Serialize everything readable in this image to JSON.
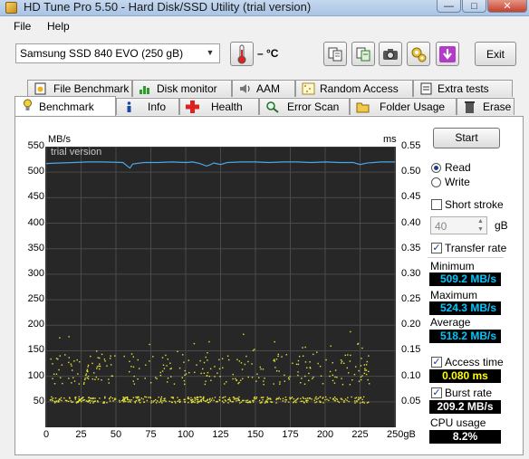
{
  "window": {
    "title": "HD Tune Pro 5.50 - Hard Disk/SSD Utility (trial version)",
    "min_glyph": "—",
    "max_glyph": "□",
    "close_glyph": "✕"
  },
  "menu": {
    "file": "File",
    "help": "Help"
  },
  "toolbar": {
    "drive": "Samsung SSD 840 EVO (250 gB)",
    "temperature": "– °C",
    "exit_label": "Exit"
  },
  "tabs_top": [
    "File Benchmark",
    "Disk monitor",
    "AAM",
    "Random Access",
    "Extra tests"
  ],
  "tabs_bottom": [
    "Benchmark",
    "Info",
    "Health",
    "Error Scan",
    "Folder Usage",
    "Erase"
  ],
  "active_tab": "Benchmark",
  "controls": {
    "start_label": "Start",
    "read_label": "Read",
    "write_label": "Write",
    "read_selected": true,
    "short_stroke_label": "Short stroke",
    "short_stroke_checked": false,
    "short_stroke_value": "40",
    "short_stroke_unit": "gB",
    "transfer_rate_label": "Transfer rate",
    "transfer_rate_checked": true,
    "access_time_label": "Access time",
    "access_time_checked": true,
    "burst_rate_label": "Burst rate",
    "burst_rate_checked": true
  },
  "stats": {
    "minimum_label": "Minimum",
    "minimum_value": "509.2 MB/s",
    "maximum_label": "Maximum",
    "maximum_value": "524.3 MB/s",
    "average_label": "Average",
    "average_value": "518.2 MB/s",
    "access_time_value": "0.080 ms",
    "burst_rate_value": "209.2 MB/s",
    "cpu_usage_label": "CPU usage",
    "cpu_usage_value": "8.2%"
  },
  "colors": {
    "chart_bg": "#272727",
    "grid": "#4a4a4a",
    "transfer_line": "#4aa7e8",
    "access_points": "#e7e33a",
    "value_cyan": "#00c8ff",
    "value_yellow": "#ffff00"
  },
  "chart_data": {
    "type": "line",
    "watermark": "trial version",
    "ylabel_left": "MB/s",
    "ylabel_right": "ms",
    "xlabel_unit": "gB",
    "x_ticks": [
      "0",
      "25",
      "50",
      "75",
      "100",
      "125",
      "150",
      "175",
      "200",
      "225",
      "250gB"
    ],
    "y_left_ticks": [
      "550",
      "500",
      "450",
      "400",
      "350",
      "300",
      "250",
      "200",
      "150",
      "100",
      "50"
    ],
    "y_right_ticks": [
      "0.55",
      "0.50",
      "0.45",
      "0.40",
      "0.35",
      "0.30",
      "0.25",
      "0.20",
      "0.15",
      "0.10",
      "0.05"
    ],
    "xlim": [
      0,
      250
    ],
    "ylim_left": [
      0,
      550
    ],
    "ylim_right": [
      0,
      0.55
    ],
    "series": [
      {
        "name": "Transfer rate",
        "axis": "left",
        "x": [
          0,
          10,
          20,
          30,
          40,
          55,
          60,
          62,
          70,
          80,
          90,
          100,
          105,
          110,
          115,
          118,
          120,
          125,
          130,
          140,
          150,
          160,
          170,
          180,
          190,
          200,
          210,
          220,
          225,
          230,
          240,
          250
        ],
        "y": [
          517,
          518,
          519,
          520,
          520,
          519,
          508,
          516,
          519,
          519,
          520,
          519,
          520,
          517,
          512,
          515,
          518,
          515,
          519,
          520,
          520,
          519,
          520,
          520,
          519,
          520,
          519,
          519,
          515,
          518,
          520,
          520
        ]
      },
      {
        "name": "Access time",
        "axis": "right",
        "style": "scatter",
        "bands": [
          {
            "y_center": 0.055,
            "spread": 0.006,
            "count": 420
          },
          {
            "y_center": 0.115,
            "spread": 0.03,
            "count": 260
          },
          {
            "y_center": 0.165,
            "spread": 0.025,
            "count": 25
          }
        ]
      }
    ]
  }
}
